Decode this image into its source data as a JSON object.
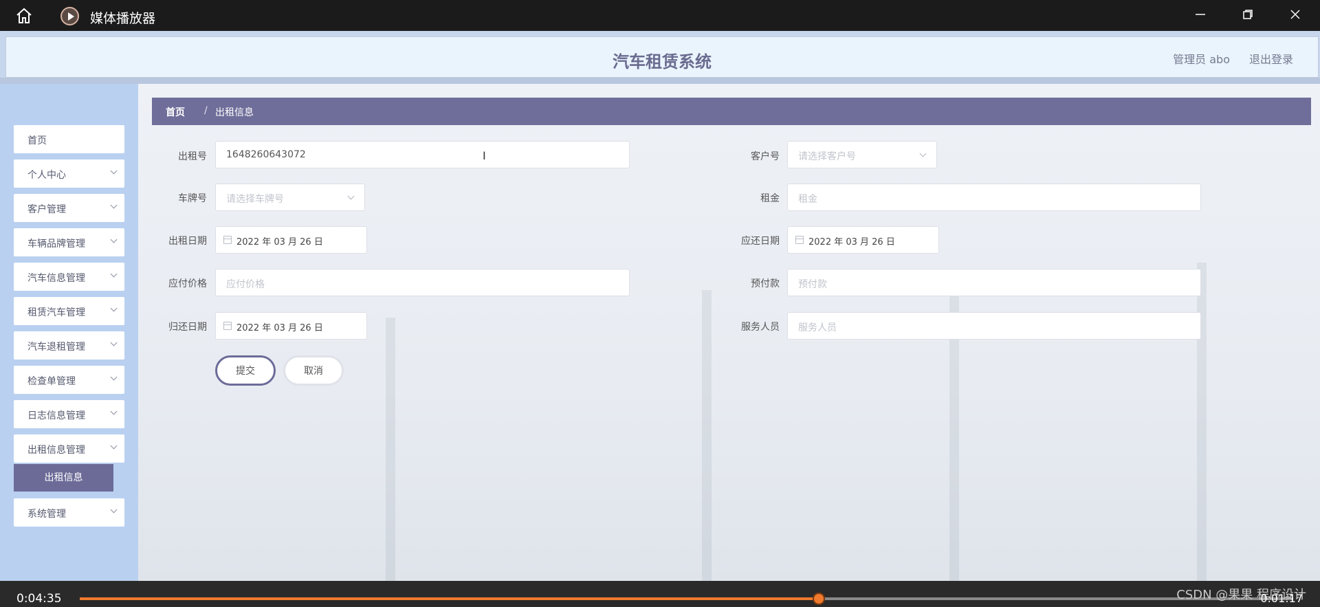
{
  "player": {
    "title": "媒体播放器",
    "elapsed": "0:04:35",
    "remaining": "0:01:17",
    "progress_fraction": 0.609,
    "accent_color": "#f07a2d",
    "watermark": "CSDN @果果 程序设计"
  },
  "header": {
    "title": "汽车租赁系统",
    "admin": "管理员 abo",
    "logout": "退出登录"
  },
  "sidebar": {
    "items": [
      {
        "label": "首页",
        "chevron": false
      },
      {
        "label": "个人中心",
        "chevron": true
      },
      {
        "label": "客户管理",
        "chevron": true
      },
      {
        "label": "车辆品牌管理",
        "chevron": true
      },
      {
        "label": "汽车信息管理",
        "chevron": true
      },
      {
        "label": "租赁汽车管理",
        "chevron": true
      },
      {
        "label": "汽车退租管理",
        "chevron": true
      },
      {
        "label": "检查单管理",
        "chevron": true
      },
      {
        "label": "日志信息管理",
        "chevron": true
      },
      {
        "label": "出租信息管理",
        "chevron": true
      },
      {
        "label": "系统管理",
        "chevron": true
      }
    ],
    "active_sub": "出租信息"
  },
  "breadcrumb": {
    "home": "首页",
    "separator": "/",
    "current": "出租信息"
  },
  "form": {
    "rental_no": {
      "label": "出租号",
      "value": "1648260643072"
    },
    "customer_no": {
      "label": "客户号",
      "placeholder": "请选择客户号"
    },
    "plate_no": {
      "label": "车牌号",
      "placeholder": "请选择车牌号"
    },
    "rent": {
      "label": "租金",
      "placeholder": "租金"
    },
    "rent_date": {
      "label": "出租日期",
      "value": "2022 年 03 月 26 日"
    },
    "due_date": {
      "label": "应还日期",
      "value": "2022 年 03 月 26 日"
    },
    "payable": {
      "label": "应付价格",
      "placeholder": "应付价格"
    },
    "deposit": {
      "label": "预付款",
      "placeholder": "预付款"
    },
    "return_date": {
      "label": "归还日期",
      "value": "2022 年 03 月 26 日"
    },
    "staff": {
      "label": "服务人员",
      "placeholder": "服务人员"
    },
    "submit": "提交",
    "cancel": "取消"
  }
}
